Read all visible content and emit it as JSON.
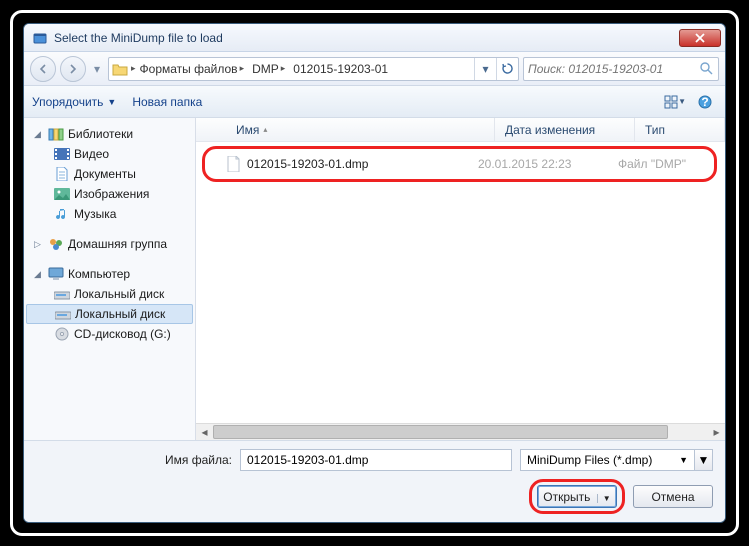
{
  "title": "Select the MiniDump file to load",
  "breadcrumb": {
    "seg1": "Форматы файлов",
    "seg2": "DMP",
    "seg3": "012015-19203-01"
  },
  "search": {
    "placeholder": "Поиск: 012015-19203-01"
  },
  "toolbar": {
    "organize": "Упорядочить",
    "newfolder": "Новая папка"
  },
  "columns": {
    "name": "Имя",
    "date": "Дата изменения",
    "type": "Тип"
  },
  "sidebar": {
    "libraries": "Библиотеки",
    "video": "Видео",
    "documents": "Документы",
    "images": "Изображения",
    "music": "Музыка",
    "homegroup": "Домашняя группа",
    "computer": "Компьютер",
    "localdisk1": "Локальный диск",
    "localdisk2": "Локальный диск",
    "cdrom": "CD-дисковод (G:)"
  },
  "file": {
    "name": "012015-19203-01.dmp",
    "date": "20.01.2015 22:23",
    "type": "Файл \"DMP\""
  },
  "footer": {
    "filename_label": "Имя файла:",
    "filename_value": "012015-19203-01.dmp",
    "filter": "MiniDump Files (*.dmp)",
    "open": "Открыть",
    "cancel": "Отмена"
  }
}
